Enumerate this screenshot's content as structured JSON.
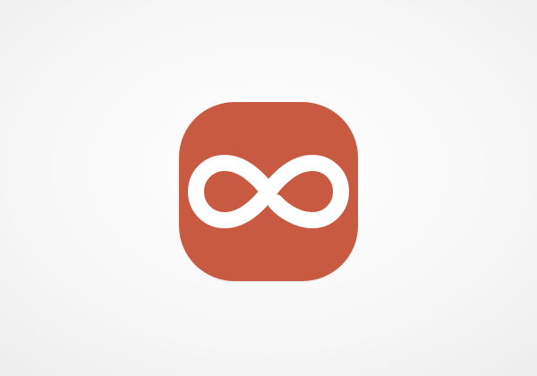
{
  "app_icon": {
    "icon": "infinity-icon",
    "background_color": "#c95a42",
    "glyph_color": "#ffffff"
  },
  "page": {
    "background_color": "#f6f6f6"
  }
}
